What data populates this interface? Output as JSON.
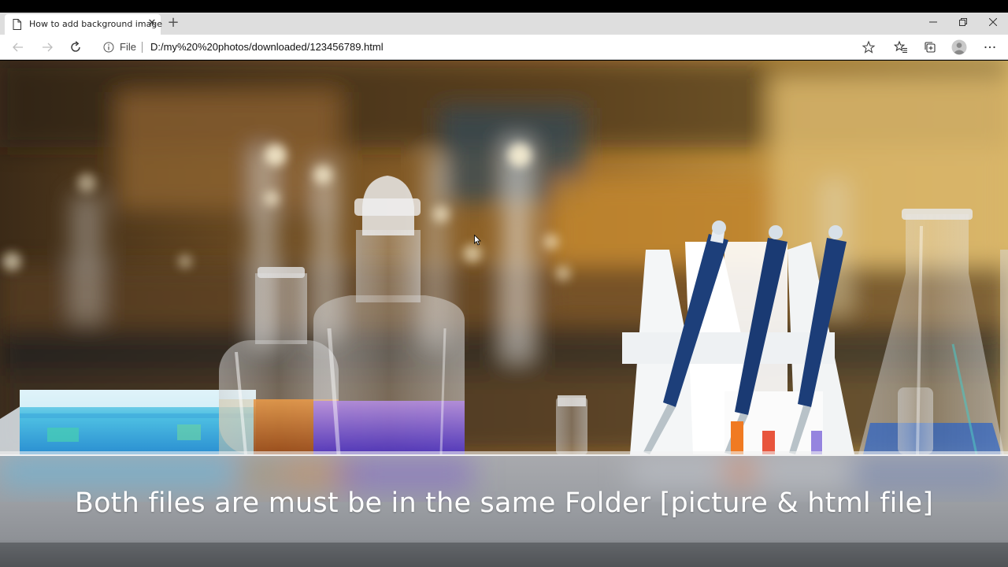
{
  "browser": {
    "tab": {
      "title": "How to add background image",
      "close_glyph": "✕",
      "page_icon": "page-icon"
    },
    "new_tab_glyph": "+",
    "window_controls": {
      "minimize": "minimize-icon",
      "maximize": "restore-icon",
      "close": "close-icon"
    },
    "toolbar": {
      "back": "back-arrow-icon",
      "forward": "forward-arrow-icon",
      "reload": "reload-icon",
      "favorites": "favorites-icon",
      "collections": "collections-icon",
      "profile": "profile-icon",
      "more": "more-icon"
    },
    "address_bar": {
      "info_icon": "info-icon",
      "scheme_label": "File",
      "url": "D:/my%20%20photos/downloaded/123456789.html",
      "star_icon": "star-icon"
    }
  },
  "page": {
    "caption": "Both files are must be in the same Folder  [picture & html file]",
    "background_image": "laboratory glassware and pipettes photo"
  },
  "colors": {
    "tab_strip": "#dedede",
    "caption_text": "#ffffff"
  }
}
